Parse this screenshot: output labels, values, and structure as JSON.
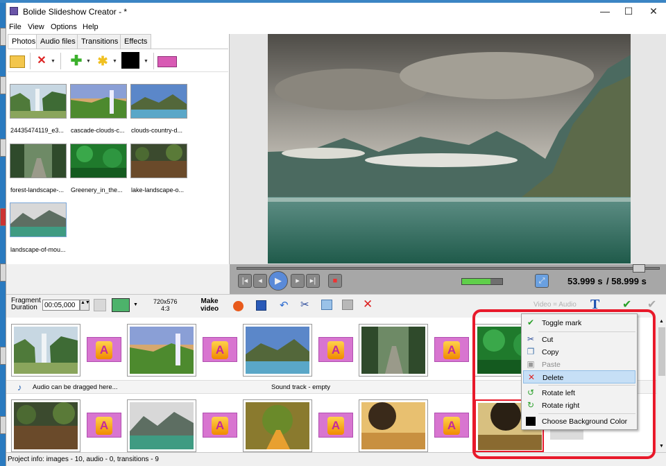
{
  "window": {
    "title": "Bolide Slideshow Creator - *",
    "min": "—",
    "max": "☐",
    "close": "✕"
  },
  "menu": [
    "File",
    "View",
    "Options",
    "Help"
  ],
  "tabs": [
    "Photos",
    "Audio files",
    "Transitions",
    "Effects"
  ],
  "photos": [
    {
      "label": "24435474119_e3..."
    },
    {
      "label": "cascade-clouds-c..."
    },
    {
      "label": "clouds-country-d..."
    },
    {
      "label": "forest-landscape-..."
    },
    {
      "label": "Greenery_in_the..."
    },
    {
      "label": "lake-landscape-o..."
    },
    {
      "label": "landscape-of-mou..."
    }
  ],
  "player": {
    "current": "53.999 s",
    "total": "/ 58.999 s",
    "progress": 0.95,
    "volume": 0.7
  },
  "toolbar": {
    "fragment_label_1": "Fragment",
    "fragment_label_2": "Duration",
    "duration": "00:05,000",
    "resolution": "720x576",
    "aspect": "4:3",
    "make_1": "Make",
    "make_2": "video",
    "video_audio": "Video = Audio"
  },
  "audio": {
    "hint": "Audio can be dragged here...",
    "track": "Sound track - empty"
  },
  "context_menu": {
    "items": [
      "Toggle mark",
      "Cut",
      "Copy",
      "Paste",
      "Delete",
      "Rotate left",
      "Rotate right",
      "Choose Background Color"
    ]
  },
  "status": {
    "text": "Project info: images - 10, audio - 0, transitions - 9"
  },
  "colors": {
    "highlight": "#c6dff6",
    "callout": "#e8192a",
    "transition": "#d875d0"
  }
}
